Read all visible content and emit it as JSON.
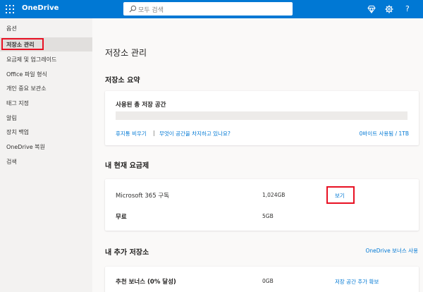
{
  "header": {
    "app_name": "OneDrive",
    "search_placeholder": "모두 검색",
    "help_label": "?"
  },
  "nav": {
    "header": "옵션",
    "items": [
      {
        "label": "저장소 관리"
      },
      {
        "label": "요금제 및 업그레이드"
      },
      {
        "label": "Office 파일 형식"
      },
      {
        "label": "개인 중요 보관소"
      },
      {
        "label": "태그 지정"
      },
      {
        "label": "알림"
      },
      {
        "label": "장치 백업"
      },
      {
        "label": "OneDrive 복원"
      },
      {
        "label": "검색"
      }
    ]
  },
  "main": {
    "page_title": "저장소 관리",
    "summary": {
      "title": "저장소 요약",
      "total_label": "사용된 총 저장 공간",
      "usage_fraction": 0,
      "free_up_link": "휴지통 비우기",
      "separator": "|",
      "whats_taking_link": "무엇이 공간을 차지하고 있나요?",
      "usage_text": "0바이트 사용됨 / 1TB"
    },
    "plan": {
      "title": "내 현재 요금제",
      "rows": [
        {
          "name": "Microsoft 365 구독",
          "size": "1,024GB",
          "action": "보기"
        },
        {
          "name": "무료",
          "size": "5GB",
          "action": ""
        }
      ]
    },
    "additional": {
      "title": "내 추가 저장소",
      "bonus_link": "OneDrive 보너스 사용",
      "rows": [
        {
          "name": "추천 보너스 (0% 달성)",
          "size": "0GB",
          "action": "저장 공간 추가 확보"
        }
      ]
    }
  }
}
